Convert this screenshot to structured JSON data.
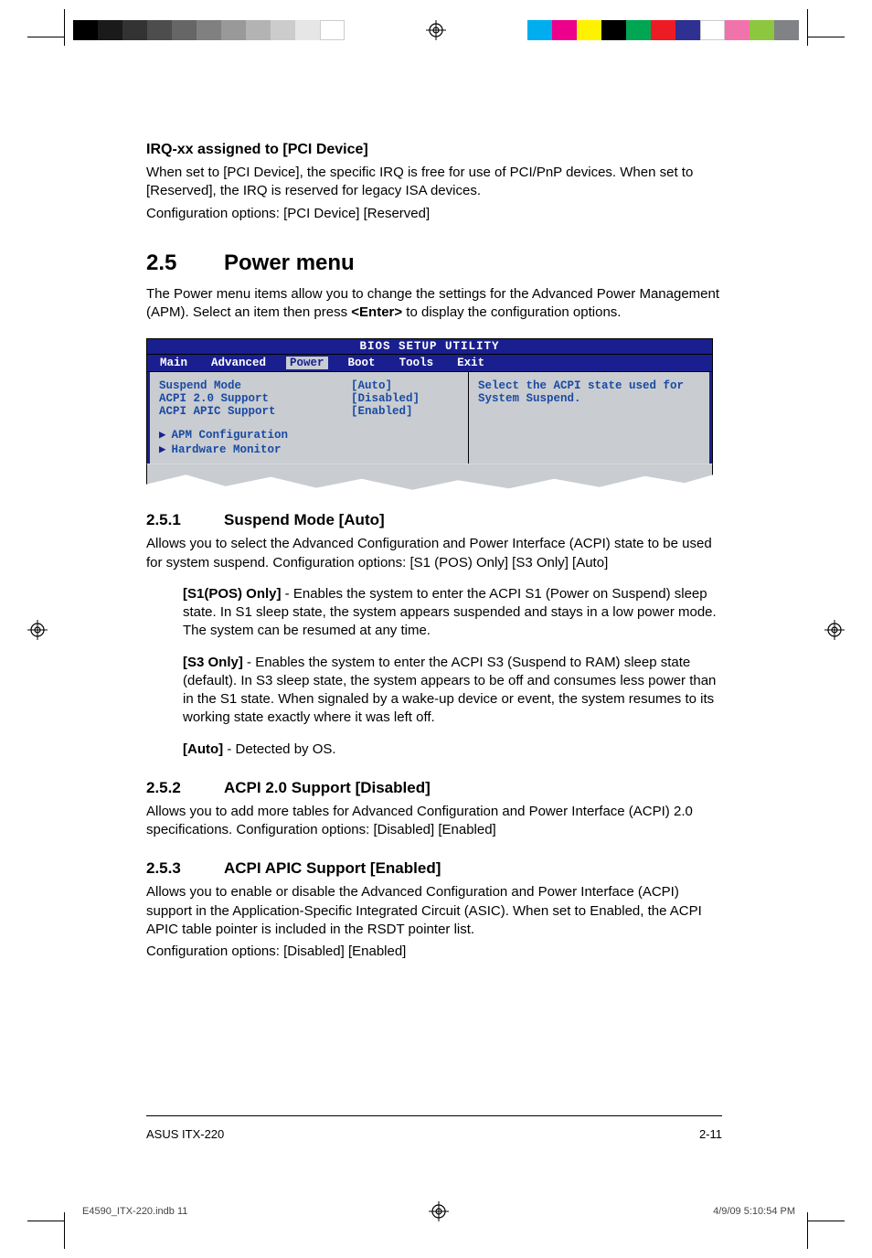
{
  "registration": {
    "gray_shades": [
      "#000000",
      "#1a1a1a",
      "#333333",
      "#4d4d4d",
      "#666666",
      "#808080",
      "#999999",
      "#b3b3b3",
      "#cccccc",
      "#e6e6e6",
      "#ffffff"
    ],
    "color_shades": [
      "#00aeef",
      "#ec008c",
      "#fff200",
      "#000000",
      "#00a651",
      "#ed1c24",
      "#2e3192",
      "#ffffff",
      "#f173ac",
      "#8dc63f",
      "#808285"
    ]
  },
  "irq": {
    "heading": "IRQ-xx assigned to [PCI Device]",
    "line1": "When set to [PCI Device], the specific IRQ is free for use of PCI/PnP devices. When set to [Reserved], the IRQ is reserved for legacy ISA devices.",
    "line2": "Configuration options: [PCI Device] [Reserved]"
  },
  "section25": {
    "num": "2.5",
    "title": "Power menu",
    "intro_a": "The Power menu items allow you to change the settings for the Advanced Power Management (APM). Select an item then press ",
    "enter": "<Enter>",
    "intro_b": " to display the configuration options."
  },
  "bios": {
    "title": "BIOS SETUP UTILITY",
    "tabs": [
      "Main",
      "Advanced",
      "Power",
      "Boot",
      "Tools",
      "Exit"
    ],
    "active_tab": "Power",
    "rows": [
      {
        "label": "Suspend Mode",
        "value": "[Auto]"
      },
      {
        "label": "ACPI 2.0 Support",
        "value": "[Disabled]"
      },
      {
        "label": "ACPI APIC Support",
        "value": "[Enabled]"
      }
    ],
    "submenus": [
      "APM Configuration",
      "Hardware Monitor"
    ],
    "help": "Select the ACPI state used for System Suspend."
  },
  "s251": {
    "num": "2.5.1",
    "title": "Suspend Mode [Auto]",
    "para": "Allows you to select the Advanced Configuration and Power Interface (ACPI) state to be used for system suspend. Configuration options: [S1 (POS) Only] [S3 Only] [Auto]",
    "opt1_lead": "[S1(POS) Only]",
    "opt1_body": " - Enables the system to enter the ACPI S1 (Power on Suspend) sleep state. In S1 sleep state, the system appears suspended and stays in a low power mode. The system can be resumed at any time.",
    "opt2_lead": "[S3 Only]",
    "opt2_body": " - Enables the system to enter the ACPI S3 (Suspend to RAM) sleep state (default). In S3 sleep state, the system appears to be off and consumes less power than in the S1 state. When signaled by a wake-up device or event, the system resumes to its working state exactly where it was left off.",
    "opt3_lead": "[Auto]",
    "opt3_body": " - Detected by OS."
  },
  "s252": {
    "num": "2.5.2",
    "title": "ACPI 2.0 Support [Disabled]",
    "para": "Allows you to add more tables for Advanced Configuration and Power Interface (ACPI) 2.0 specifications. Configuration options: [Disabled] [Enabled]"
  },
  "s253": {
    "num": "2.5.3",
    "title": "ACPI APIC Support [Enabled]",
    "para1": "Allows you to enable or disable the Advanced Configuration and Power Interface (ACPI) support in the Application-Specific Integrated Circuit (ASIC). When set to Enabled, the ACPI APIC table pointer is included in the RSDT pointer list.",
    "para2": "Configuration options: [Disabled] [Enabled]"
  },
  "footer": {
    "left": "ASUS ITX-220",
    "right": "2-11"
  },
  "print_footer": {
    "left": "E4590_ITX-220.indb   11",
    "right": "4/9/09   5:10:54 PM"
  }
}
